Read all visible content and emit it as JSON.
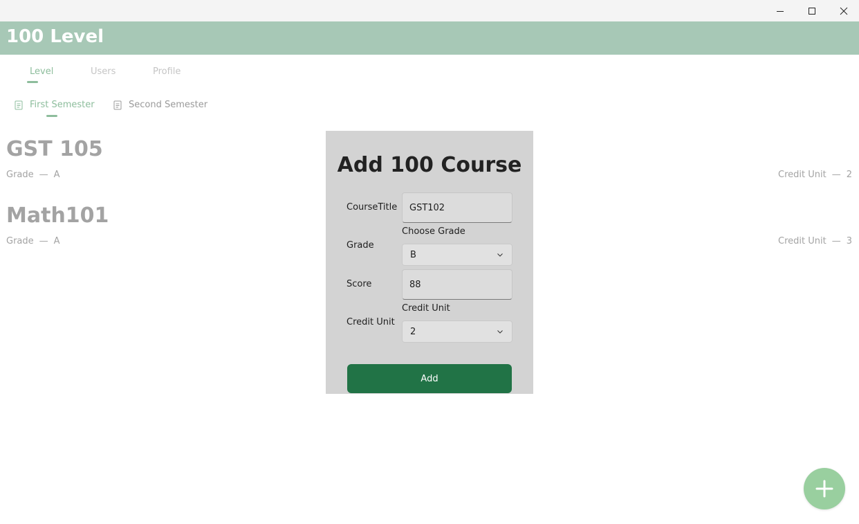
{
  "window": {
    "controls": [
      "minimize-icon",
      "maximize-icon",
      "close-icon"
    ]
  },
  "appbar": {
    "title": "100 Level",
    "color": "#a7c8b6"
  },
  "tabs": [
    {
      "label": "Level",
      "active": true
    },
    {
      "label": "Users",
      "active": false
    },
    {
      "label": "Profile",
      "active": false
    }
  ],
  "semesters": [
    {
      "label": "First Semester",
      "active": true,
      "icon": "document-icon"
    },
    {
      "label": "Second Semester",
      "active": false,
      "icon": "document-icon"
    }
  ],
  "courses": [
    {
      "title": "GST 105",
      "grade_label": "Grade",
      "separator": "—",
      "grade": "A",
      "credit_label": "Credit Unit",
      "credit": "2"
    },
    {
      "title": "Math101",
      "grade_label": "Grade",
      "separator": "—",
      "grade": "A",
      "credit_label": "Credit Unit",
      "credit": "3"
    }
  ],
  "dialog": {
    "title": "Add 100 Course",
    "course_title": {
      "label": "CourseTitle",
      "value": "GST102"
    },
    "grade": {
      "label": "Grade",
      "helper": "Choose Grade",
      "value": "B"
    },
    "score": {
      "label": "Score",
      "value": "88"
    },
    "credit_unit": {
      "label": "Credit Unit",
      "helper": "Credit Unit",
      "value": "2"
    },
    "add_label": "Add"
  },
  "fab": {
    "icon": "plus-icon"
  },
  "colors": {
    "accent": "#8dbd9c",
    "primary_button": "#217346",
    "fab": "#99cf9f"
  }
}
